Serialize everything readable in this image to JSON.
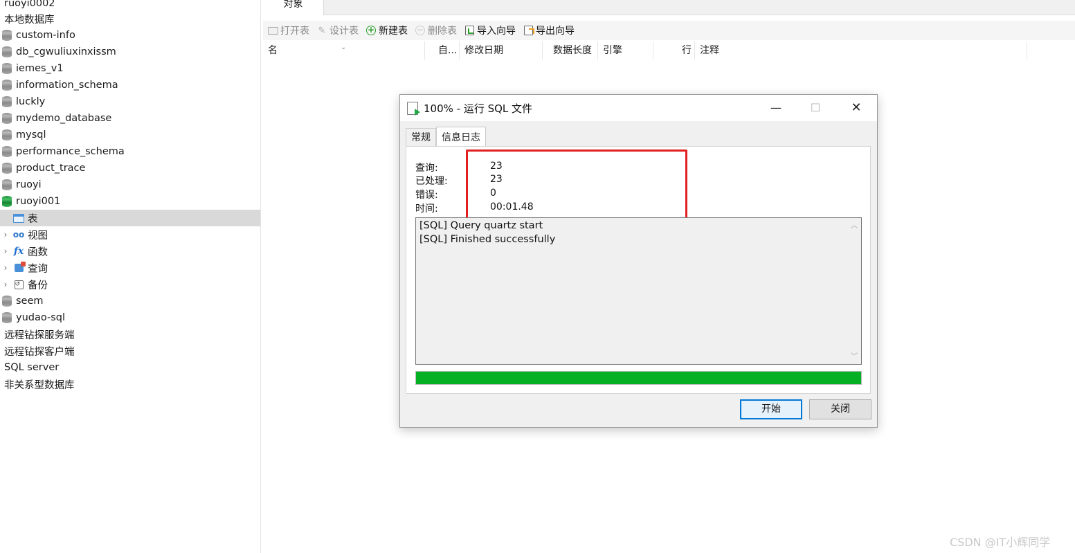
{
  "sidebar": {
    "items": [
      {
        "label": "ruoyi0002",
        "type": "plain"
      },
      {
        "label": "本地数据库",
        "type": "plain"
      },
      {
        "label": "custom-info",
        "type": "db"
      },
      {
        "label": "db_cgwuliuxinxissm",
        "type": "db"
      },
      {
        "label": "iemes_v1",
        "type": "db"
      },
      {
        "label": "information_schema",
        "type": "db"
      },
      {
        "label": "luckly",
        "type": "db"
      },
      {
        "label": "mydemo_database",
        "type": "db"
      },
      {
        "label": "mysql",
        "type": "db"
      },
      {
        "label": "performance_schema",
        "type": "db"
      },
      {
        "label": "product_trace",
        "type": "db"
      },
      {
        "label": "ruoyi",
        "type": "db"
      },
      {
        "label": "ruoyi001",
        "type": "db-open"
      },
      {
        "label": "表",
        "type": "sub-table"
      },
      {
        "label": "视图",
        "type": "sub-view"
      },
      {
        "label": "函数",
        "type": "sub-func"
      },
      {
        "label": "查询",
        "type": "sub-query"
      },
      {
        "label": "备份",
        "type": "sub-backup"
      },
      {
        "label": "seem",
        "type": "db"
      },
      {
        "label": "yudao-sql",
        "type": "db"
      },
      {
        "label": "远程钻探服务端",
        "type": "plain"
      },
      {
        "label": "远程钻探客户端",
        "type": "plain"
      },
      {
        "label": "SQL server",
        "type": "plain"
      },
      {
        "label": "非关系型数据库",
        "type": "plain"
      }
    ]
  },
  "main": {
    "tab_label": "对象",
    "toolbar": {
      "open_table": "打开表",
      "design_table": "设计表",
      "new_table": "新建表",
      "delete_table": "删除表",
      "import_wizard": "导入向导",
      "export_wizard": "导出向导"
    },
    "columns": {
      "name": "名",
      "auto": "自...",
      "modified": "修改日期",
      "data_length": "数据长度",
      "engine": "引擎",
      "rows": "行",
      "comment": "注释"
    }
  },
  "dialog": {
    "title": "100% - 运行 SQL 文件",
    "tabs": [
      "常规",
      "信息日志"
    ],
    "stats": {
      "query_label": "查询:",
      "query_value": "23",
      "processed_label": "已处理:",
      "processed_value": "23",
      "error_label": "错误:",
      "error_value": "0",
      "time_label": "时间:",
      "time_value": "00:01.48"
    },
    "log": [
      "[SQL] Query quartz start",
      "[SQL] Finished successfully"
    ],
    "progress": 1.0,
    "progress_color": "#06b025",
    "highlight_color": "#e02020",
    "buttons": {
      "start": "开始",
      "close": "关闭"
    }
  },
  "watermark": "CSDN @IT小辉同学"
}
